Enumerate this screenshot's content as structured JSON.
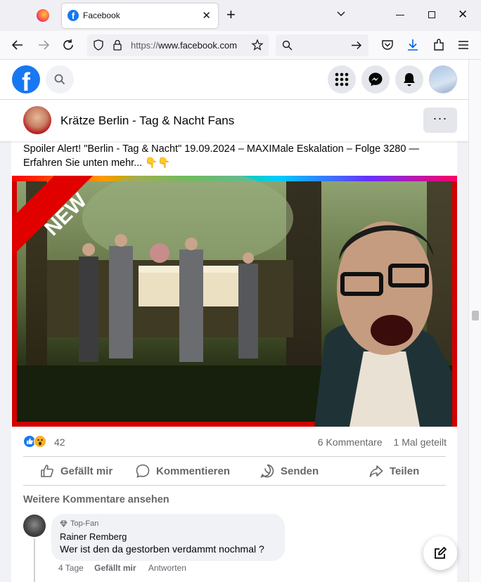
{
  "browser": {
    "tab_title": "Facebook",
    "url": "https://www.facebook.com"
  },
  "page": {
    "name": "Krätze Berlin - Tag & Nacht Fans",
    "more_label": "···"
  },
  "post": {
    "text": "Spoiler Alert! \"Berlin - Tag & Nacht\" 19.09.2024 – MAXIMale Eskalation – Folge 3280 — Erfahren Sie unten mehr... 👇👇",
    "image_badge": "NEW",
    "reaction_count": "42",
    "comments_count": "6 Kommentare",
    "shares": "1 Mal geteilt"
  },
  "actions": {
    "like": "Gefällt mir",
    "comment": "Kommentieren",
    "send": "Senden",
    "share": "Teilen"
  },
  "comments": {
    "more_label": "Weitere Kommentare ansehen",
    "items": [
      {
        "badge": "Top-Fan",
        "author": "Rainer Remberg",
        "text": "Wer ist den da gestorben verdammt nochmal ?",
        "time": "4 Tage",
        "like": "Gefällt mir",
        "reply": "Antworten"
      }
    ]
  },
  "colors": {
    "facebook_blue": "#1877f2",
    "secondary_text": "#65676b",
    "like_blue": "#1877f2",
    "wow_yellow": "#f7b125"
  }
}
